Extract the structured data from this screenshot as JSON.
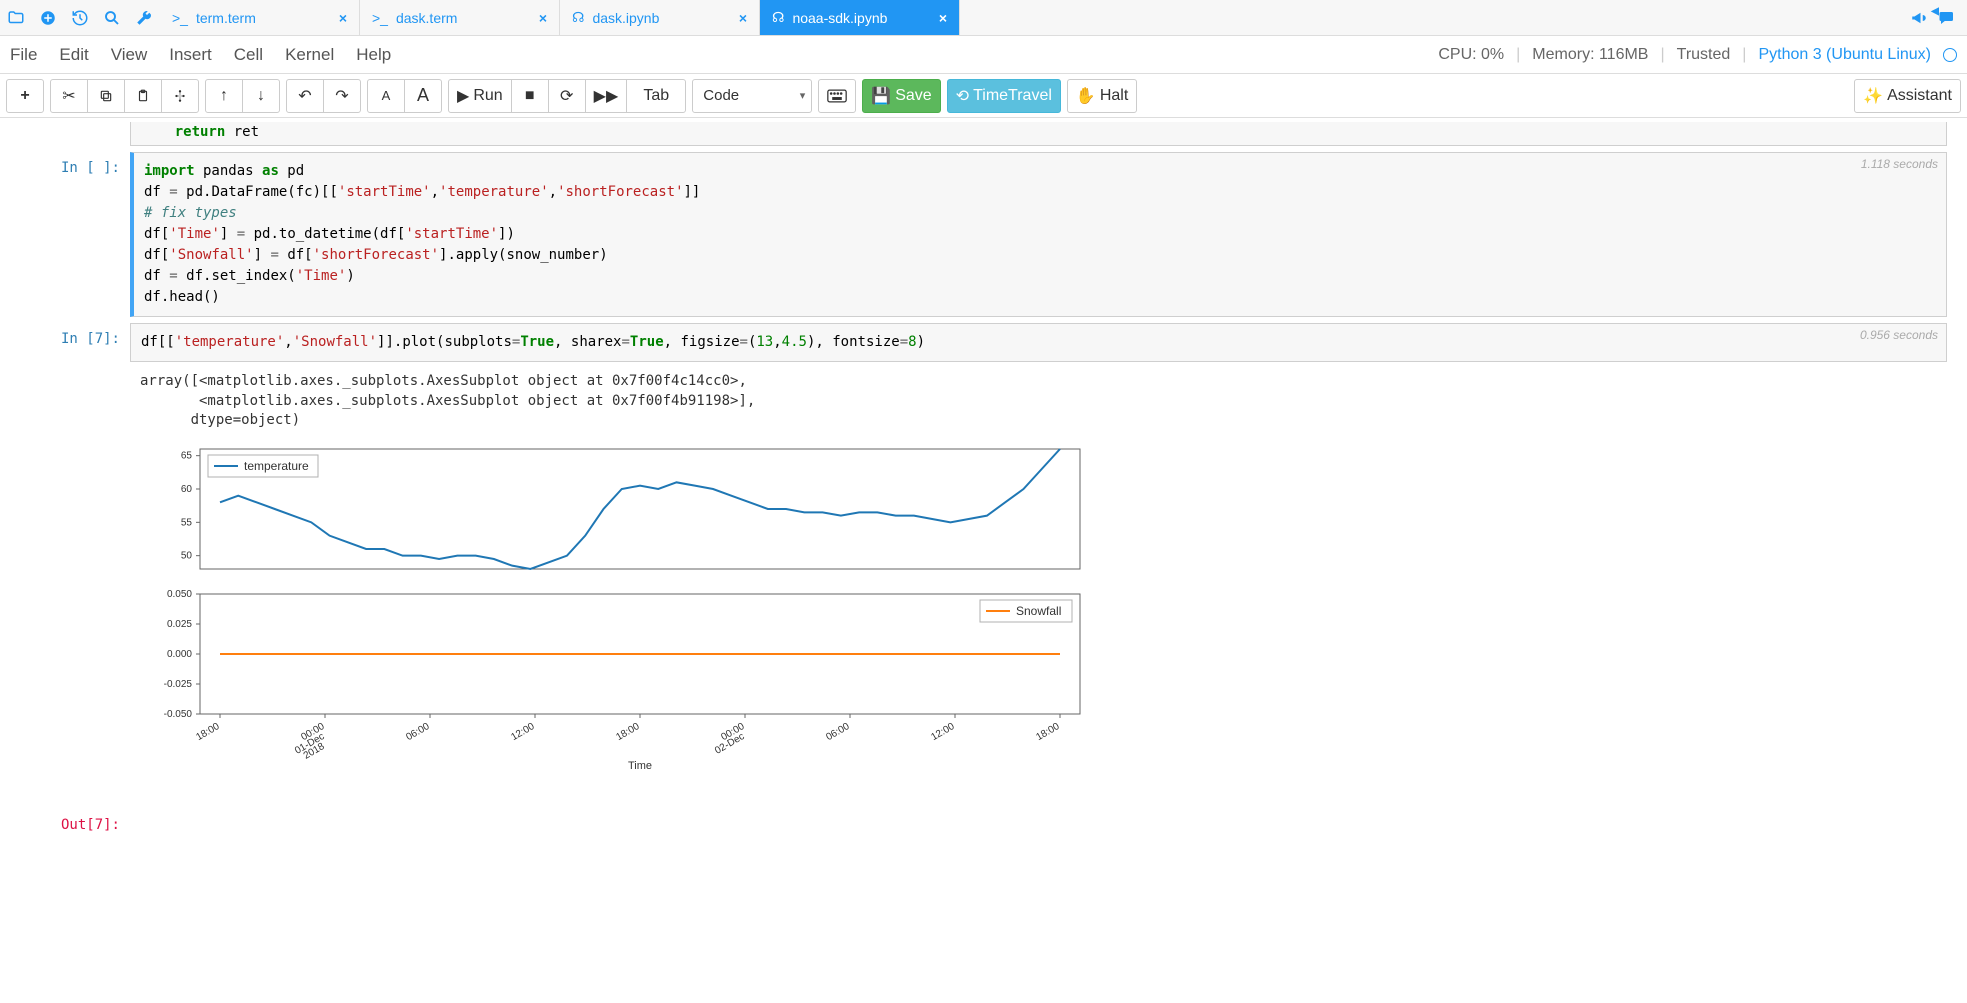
{
  "topbar": {
    "tabs": [
      {
        "label": "term.term",
        "icon": "terminal"
      },
      {
        "label": "dask.term",
        "icon": "terminal"
      },
      {
        "label": "dask.ipynb",
        "icon": "jupyter"
      },
      {
        "label": "noaa-sdk.ipynb",
        "icon": "jupyter",
        "active": true
      }
    ]
  },
  "menubar": {
    "items": [
      "File",
      "Edit",
      "View",
      "Insert",
      "Cell",
      "Kernel",
      "Help"
    ],
    "status": {
      "cpu": "CPU: 0%",
      "memory": "Memory: 116MB",
      "trusted": "Trusted",
      "kernel": "Python 3 (Ubuntu Linux)"
    }
  },
  "toolbar": {
    "run": "Run",
    "tab": "Tab",
    "celltype": "Code",
    "save": "Save",
    "timetravel": "TimeTravel",
    "halt": "Halt",
    "assistant": "Assistant"
  },
  "cells": {
    "cell_prev": {
      "code_html": "    <span class='k'>return</span> ret"
    },
    "cell1": {
      "prompt": "In [ ]:",
      "exec_time": "1.118 seconds",
      "code_html": "<span class='k'>import</span> pandas <span class='k'>as</span> pd\ndf <span class='o'>=</span> pd.DataFrame(fc)[[<span class='s'>'startTime'</span>,<span class='s'>'temperature'</span>,<span class='s'>'shortForecast'</span>]]\n<span class='c'># fix types</span>\ndf[<span class='s'>'Time'</span>] <span class='o'>=</span> pd.to_datetime(df[<span class='s'>'startTime'</span>])\ndf[<span class='s'>'Snowfall'</span>] <span class='o'>=</span> df[<span class='s'>'shortForecast'</span>].apply(snow_number)\ndf <span class='o'>=</span> df.set_index(<span class='s'>'Time'</span>)\ndf.head()"
    },
    "cell2": {
      "prompt": "In [7]:",
      "exec_time": "0.956 seconds",
      "code_html": "df[[<span class='s'>'temperature'</span>,<span class='s'>'Snowfall'</span>]].plot(subplots<span class='o'>=</span><span class='bool'>True</span>, sharex<span class='o'>=</span><span class='bool'>True</span>, figsize<span class='o'>=</span>(<span class='num'>13</span>,<span class='num'>4.5</span>), fontsize<span class='o'>=</span><span class='num'>8</span>)",
      "output_text": "array([<matplotlib.axes._subplots.AxesSubplot object at 0x7f00f4c14cc0>,\n       <matplotlib.axes._subplots.AxesSubplot object at 0x7f00f4b91198>],\n      dtype=object)"
    },
    "out7": {
      "prompt": "Out[7]:"
    }
  },
  "chart_data": [
    {
      "type": "line",
      "series": [
        {
          "name": "temperature",
          "values": [
            58,
            59,
            58,
            57,
            56,
            55,
            53,
            52,
            51,
            51,
            50,
            50,
            49.5,
            50,
            50,
            49.5,
            48.5,
            48,
            49,
            50,
            53,
            57,
            60,
            60.5,
            60,
            61,
            60.5,
            60,
            59,
            58,
            57,
            57,
            56.5,
            56.5,
            56,
            56.5,
            56.5,
            56,
            56,
            55.5,
            55,
            55.5,
            56,
            58,
            60,
            63,
            66
          ]
        }
      ],
      "x_ticks": [
        "18:00",
        "00:00\n01-Dec\n2018",
        "06:00",
        "12:00",
        "18:00",
        "00:00\n02-Dec",
        "06:00",
        "12:00",
        "18:00"
      ],
      "ylim": [
        48,
        66
      ],
      "y_ticks": [
        50,
        55,
        60,
        65
      ],
      "legend_pos": "upper-left",
      "color": "#1f77b4"
    },
    {
      "type": "line",
      "series": [
        {
          "name": "Snowfall",
          "values": [
            0,
            0,
            0,
            0,
            0,
            0,
            0,
            0,
            0,
            0,
            0,
            0,
            0,
            0,
            0,
            0,
            0,
            0,
            0,
            0,
            0,
            0,
            0,
            0,
            0,
            0,
            0,
            0,
            0,
            0,
            0,
            0,
            0,
            0,
            0,
            0,
            0,
            0,
            0,
            0,
            0,
            0,
            0,
            0,
            0,
            0,
            0
          ]
        }
      ],
      "x_ticks": [
        "18:00",
        "00:00\n01-Dec\n2018",
        "06:00",
        "12:00",
        "18:00",
        "00:00\n02-Dec",
        "06:00",
        "12:00",
        "18:00"
      ],
      "ylim": [
        -0.05,
        0.05
      ],
      "y_ticks": [
        -0.05,
        -0.025,
        0.0,
        0.025,
        0.05
      ],
      "xlabel": "Time",
      "legend_pos": "upper-right",
      "color": "#ff7f0e"
    }
  ]
}
